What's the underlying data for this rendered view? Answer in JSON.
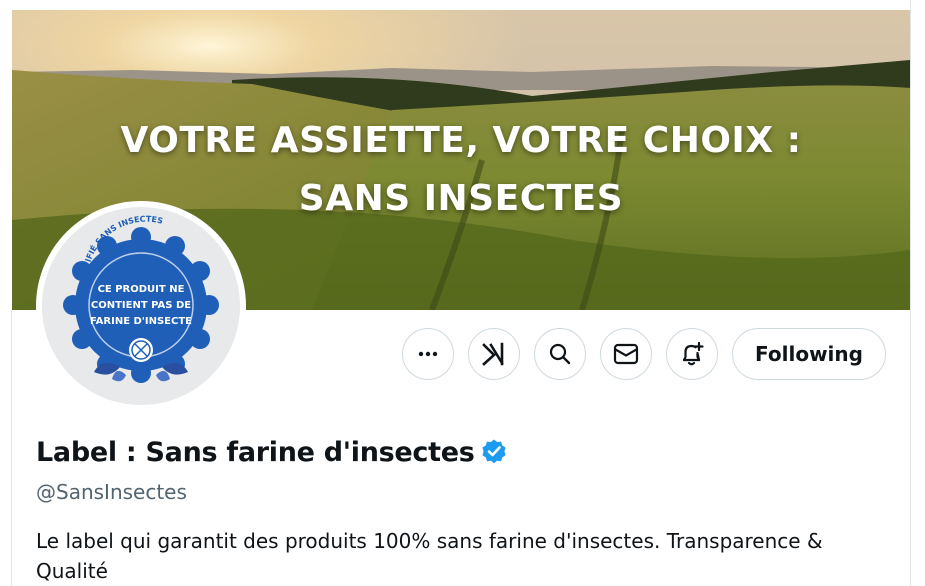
{
  "banner": {
    "headline_line1": "VOTRE ASSIETTE, VOTRE CHOIX :",
    "headline_line2": "SANS INSECTES"
  },
  "avatar": {
    "seal_arc_text": "CERTIFIÉ SANS INSECTES",
    "seal_line1": "CE PRODUIT NE",
    "seal_line2": "CONTIENT PAS DE",
    "seal_line3": "FARINE D'INSECTE"
  },
  "actions": [
    {
      "name": "more-icon"
    },
    {
      "name": "grok-icon"
    },
    {
      "name": "search-icon"
    },
    {
      "name": "message-icon"
    },
    {
      "name": "notification-bell-icon"
    }
  ],
  "follow_button": {
    "label": "Following"
  },
  "profile": {
    "display_name": "Label : Sans farine d'insectes",
    "handle": "@SansInsectes",
    "bio": "Le label qui garantit des produits 100% sans farine d'insectes. Transparence & Qualité"
  },
  "colors": {
    "verified_blue": "#1d9bf0",
    "seal_blue": "#1f5fb8",
    "text_primary": "#0f1419",
    "text_secondary": "#536471",
    "border": "#cfd9de"
  }
}
